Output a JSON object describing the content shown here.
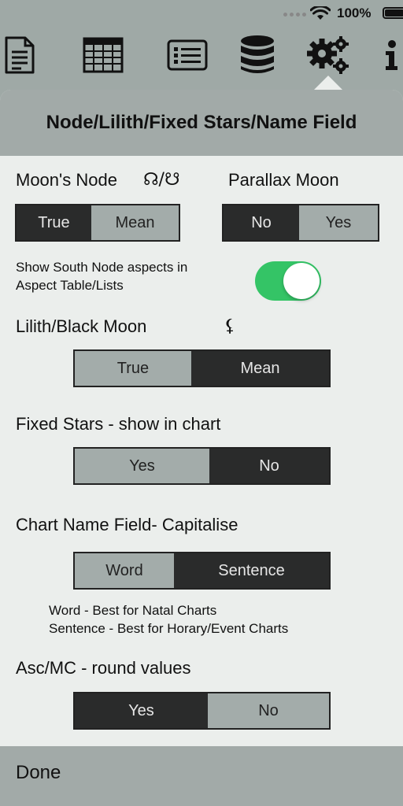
{
  "status_bar": {
    "battery_percent": "100%"
  },
  "toolbar": {
    "items": [
      "document-icon",
      "spreadsheet-icon",
      "list-icon",
      "database-icon",
      "settings-gears-icon",
      "info-icon"
    ],
    "active": "settings-gears-icon"
  },
  "panel": {
    "title": "Node/Lilith/Fixed Stars/Name Field",
    "moons_node": {
      "label": "Moon's Node",
      "symbol": "☊/☋",
      "options": [
        "True",
        "Mean"
      ],
      "selected": "Mean"
    },
    "parallax_moon": {
      "label": "Parallax Moon",
      "options": [
        "No",
        "Yes"
      ],
      "selected": "Yes"
    },
    "south_node_aspects": {
      "label_line1": "Show South Node aspects in",
      "label_line2": "Aspect Table/Lists",
      "enabled": true
    },
    "lilith": {
      "label": "Lilith/Black Moon",
      "symbol": "⚸",
      "options": [
        "True",
        "Mean"
      ],
      "selected": "True"
    },
    "fixed_stars": {
      "label": "Fixed Stars - show in chart",
      "options": [
        "Yes",
        "No"
      ],
      "selected": "Yes"
    },
    "chart_name": {
      "label": "Chart Name Field- Capitalise",
      "options": [
        "Word",
        "Sentence"
      ],
      "selected": "Word",
      "note1": "Word - Best for Natal Charts",
      "note2": "Sentence - Best for Horary/Event Charts"
    },
    "asc_mc": {
      "label": "Asc/MC - round values",
      "options": [
        "Yes",
        "No"
      ],
      "selected": "No"
    },
    "done_label": "Done"
  },
  "colors": {
    "background": "#9fa9a6",
    "panel": "#ebeeec",
    "header": "#a2aaa8",
    "segment_selected": "#a3acaa",
    "segment_unselected": "#2a2b2b",
    "toggle_on": "#34c466"
  }
}
